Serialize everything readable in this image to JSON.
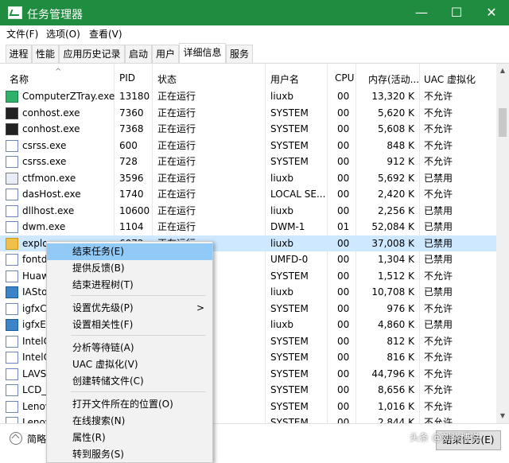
{
  "window": {
    "title": "任务管理器",
    "minimize": "—",
    "maximize": "☐",
    "close": "✕"
  },
  "menu": [
    "文件(F)",
    "选项(O)",
    "查看(V)"
  ],
  "tabs": [
    "进程",
    "性能",
    "应用历史记录",
    "启动",
    "用户",
    "详细信息",
    "服务"
  ],
  "active_tab": "详细信息",
  "table": {
    "columns": [
      "名称",
      "PID",
      "状态",
      "用户名",
      "CPU",
      "内存(活动...",
      "UAC 虚拟化"
    ],
    "sort_indicator": "^",
    "rows": [
      {
        "name": "ComputerZTray.exe",
        "pid": "13180",
        "status": "正在运行",
        "user": "liuxb",
        "cpu": "00",
        "mem": "13,320 K",
        "uac": "不允许",
        "icon": "tray-app-icon"
      },
      {
        "name": "conhost.exe",
        "pid": "7360",
        "status": "正在运行",
        "user": "SYSTEM",
        "cpu": "00",
        "mem": "5,620 K",
        "uac": "不允许",
        "icon": "console-icon"
      },
      {
        "name": "conhost.exe",
        "pid": "7368",
        "status": "正在运行",
        "user": "SYSTEM",
        "cpu": "00",
        "mem": "5,608 K",
        "uac": "不允许",
        "icon": "console-icon"
      },
      {
        "name": "csrss.exe",
        "pid": "600",
        "status": "正在运行",
        "user": "SYSTEM",
        "cpu": "00",
        "mem": "848 K",
        "uac": "不允许",
        "icon": "system-process-icon"
      },
      {
        "name": "csrss.exe",
        "pid": "728",
        "status": "正在运行",
        "user": "SYSTEM",
        "cpu": "00",
        "mem": "912 K",
        "uac": "不允许",
        "icon": "system-process-icon"
      },
      {
        "name": "ctfmon.exe",
        "pid": "3596",
        "status": "正在运行",
        "user": "liuxb",
        "cpu": "00",
        "mem": "5,692 K",
        "uac": "已禁用",
        "icon": "pen-icon"
      },
      {
        "name": "dasHost.exe",
        "pid": "1740",
        "status": "正在运行",
        "user": "LOCAL SE...",
        "cpu": "00",
        "mem": "2,420 K",
        "uac": "不允许",
        "icon": "system-process-icon"
      },
      {
        "name": "dllhost.exe",
        "pid": "10600",
        "status": "正在运行",
        "user": "liuxb",
        "cpu": "00",
        "mem": "2,256 K",
        "uac": "已禁用",
        "icon": "system-process-icon"
      },
      {
        "name": "dwm.exe",
        "pid": "1104",
        "status": "正在运行",
        "user": "DWM-1",
        "cpu": "01",
        "mem": "52,084 K",
        "uac": "已禁用",
        "icon": "system-process-icon"
      },
      {
        "name": "explorer.exe",
        "pid": "6072",
        "status": "正在运行",
        "user": "liuxb",
        "cpu": "00",
        "mem": "37,008 K",
        "uac": "已禁用",
        "icon": "folder-icon"
      },
      {
        "name": "fontdrvhost.exe",
        "pid": "",
        "status": "",
        "user": "UMFD-0",
        "cpu": "00",
        "mem": "1,304 K",
        "uac": "已禁用",
        "icon": "system-process-icon"
      },
      {
        "name": "Huawei...",
        "pid": "",
        "status": "",
        "user": "SYSTEM",
        "cpu": "00",
        "mem": "1,512 K",
        "uac": "不允许",
        "icon": "system-process-icon"
      },
      {
        "name": "IAStor...",
        "pid": "",
        "status": "",
        "user": "liuxb",
        "cpu": "00",
        "mem": "10,708 K",
        "uac": "已禁用",
        "icon": "globe-icon"
      },
      {
        "name": "igfxCU...",
        "pid": "",
        "status": "",
        "user": "SYSTEM",
        "cpu": "00",
        "mem": "976 K",
        "uac": "不允许",
        "icon": "system-process-icon"
      },
      {
        "name": "igfxEM...",
        "pid": "",
        "status": "",
        "user": "liuxb",
        "cpu": "00",
        "mem": "4,860 K",
        "uac": "已禁用",
        "icon": "graphics-icon"
      },
      {
        "name": "IntelC...",
        "pid": "",
        "status": "",
        "user": "SYSTEM",
        "cpu": "00",
        "mem": "812 K",
        "uac": "不允许",
        "icon": "system-process-icon"
      },
      {
        "name": "IntelC...",
        "pid": "",
        "status": "",
        "user": "SYSTEM",
        "cpu": "00",
        "mem": "816 K",
        "uac": "不允许",
        "icon": "system-process-icon"
      },
      {
        "name": "LAVSe...",
        "pid": "",
        "status": "",
        "user": "SYSTEM",
        "cpu": "00",
        "mem": "44,796 K",
        "uac": "不允许",
        "icon": "system-process-icon"
      },
      {
        "name": "LCD_S...",
        "pid": "",
        "status": "",
        "user": "SYSTEM",
        "cpu": "00",
        "mem": "8,656 K",
        "uac": "不允许",
        "icon": "system-process-icon"
      },
      {
        "name": "Lenovo...",
        "pid": "",
        "status": "",
        "user": "SYSTEM",
        "cpu": "00",
        "mem": "1,016 K",
        "uac": "不允许",
        "icon": "system-process-icon"
      },
      {
        "name": "Lenovo...",
        "pid": "",
        "status": "",
        "user": "SYSTEM",
        "cpu": "00",
        "mem": "2,844 K",
        "uac": "不允许",
        "icon": "system-process-icon"
      }
    ]
  },
  "context_menu": {
    "items": [
      "结束任务(E)",
      "提供反馈(B)",
      "结束进程树(T)",
      "设置优先级(P)",
      "设置相关性(F)",
      "分析等待链(A)",
      "UAC 虚拟化(V)",
      "创建转储文件(C)",
      "打开文件所在的位置(O)",
      "在线搜索(N)",
      "属性(R)",
      "转到服务(S)"
    ],
    "submenu_arrow": ">"
  },
  "footer": {
    "summary_label": "简略信息(D)",
    "end_task_button": "结束任务(E)"
  },
  "watermark": "头条 @刘晓博说",
  "colors": {
    "title_bar": "#1f8c3f",
    "selection": "#cde8ff",
    "menu_hover": "#91c9f7"
  }
}
